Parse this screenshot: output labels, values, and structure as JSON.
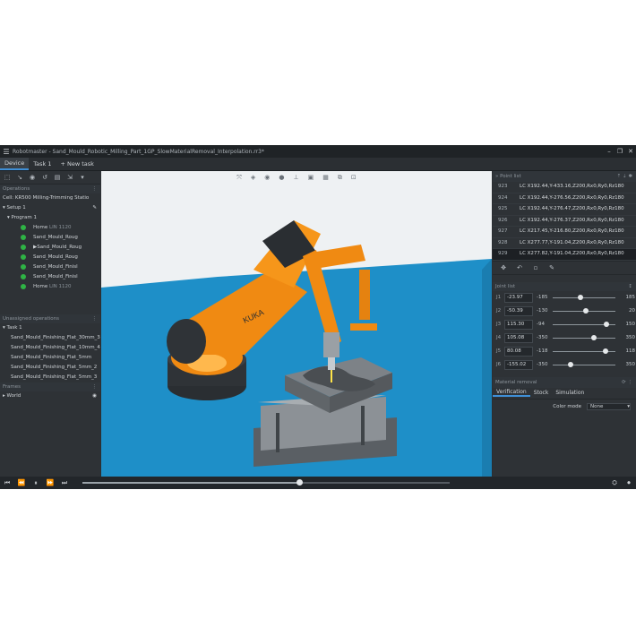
{
  "title": "Robotmaster - Sand_Mould_Robotic_Milling_Part_1GP_SlowMaterialRemoval_Interpolation.rr3*",
  "tabs": [
    {
      "label": "Device"
    },
    {
      "label": "Task 1"
    },
    {
      "label": "New task",
      "prefix": "+"
    }
  ],
  "left": {
    "operations_header": "Operations",
    "cell": "Cell: KR500 Milling-Trimming Statio",
    "setup": "Setup 1",
    "program": "Program 1",
    "ops": [
      {
        "name": "Home",
        "extra": "LIN 1120",
        "marker": ""
      },
      {
        "name": "Sand_Mould_Roug",
        "extra": "",
        "marker": ""
      },
      {
        "name": "Sand_Mould_Roug",
        "extra": "",
        "marker": "▶"
      },
      {
        "name": "Sand_Mould_Roug",
        "extra": "",
        "marker": ""
      },
      {
        "name": "Sand_Mould_Finisl",
        "extra": "",
        "marker": ""
      },
      {
        "name": "Sand_Mould_Finisl",
        "extra": "",
        "marker": ""
      },
      {
        "name": "Home",
        "extra": "LIN 1120",
        "marker": ""
      }
    ],
    "unassigned_header": "Unassigned operations",
    "task": "Task 1",
    "unassigned": [
      "Sand_Mould_Finishing_Flat_30mm_3",
      "Sand_Mould_Finishing_Flat_10mm_4",
      "Sand_Mould_Finishing_Flat_5mm",
      "Sand_Mould_Finishing_Flat_5mm_2",
      "Sand_Mould_Finishing_Flat_5mm_3"
    ],
    "frames_header": "Frames",
    "world": "World"
  },
  "right": {
    "point_list_header": "Point list",
    "points": [
      {
        "n": "923",
        "v": "LC  X192.44,Y-433.16,Z200,Rx0,Ry0,Rz180"
      },
      {
        "n": "924",
        "v": "LC  X192.44,Y-276.56,Z200,Rx0,Ry0,Rz180"
      },
      {
        "n": "925",
        "v": "LC  X192.44,Y-276.47,Z200,Rx0,Ry0,Rz180"
      },
      {
        "n": "926",
        "v": "LC  X192.44,Y-276.37,Z200,Rx0,Ry0,Rz180"
      },
      {
        "n": "927",
        "v": "LC  X217.45,Y-216.80,Z200,Rx0,Ry0,Rz180"
      },
      {
        "n": "928",
        "v": "LC  X277.77,Y-191.04,Z200,Rx0,Ry0,Rz180"
      },
      {
        "n": "929",
        "v": "LC  X277.82,Y-191.04,Z200,Rx0,Ry0,Rz180"
      }
    ],
    "joint_list_header": "Joint list",
    "joints": [
      {
        "label": "J1",
        "value": "-23.97",
        "min": "-185",
        "max": "185",
        "pos": 0.44
      },
      {
        "label": "J2",
        "value": "-50.39",
        "min": "-130",
        "max": "20",
        "pos": 0.53
      },
      {
        "label": "J3",
        "value": "115.30",
        "min": "-94",
        "max": "150",
        "pos": 0.86
      },
      {
        "label": "J4",
        "value": "105.08",
        "min": "-350",
        "max": "350",
        "pos": 0.65
      },
      {
        "label": "J5",
        "value": "80.08",
        "min": "-118",
        "max": "118",
        "pos": 0.84
      },
      {
        "label": "J6",
        "value": "-155.02",
        "min": "-350",
        "max": "350",
        "pos": 0.28
      }
    ],
    "material_removal_header": "Material removal",
    "sub_tabs": [
      "Verification",
      "Stock",
      "Simulation"
    ],
    "color_mode_label": "Color mode",
    "color_mode_value": "None"
  },
  "colors": {
    "robot": "#f08a12",
    "floor": "#1e8fc8",
    "accent": "#3f8fd6",
    "status_ok": "#2fb345"
  },
  "playback": {
    "progress": 0.59
  }
}
